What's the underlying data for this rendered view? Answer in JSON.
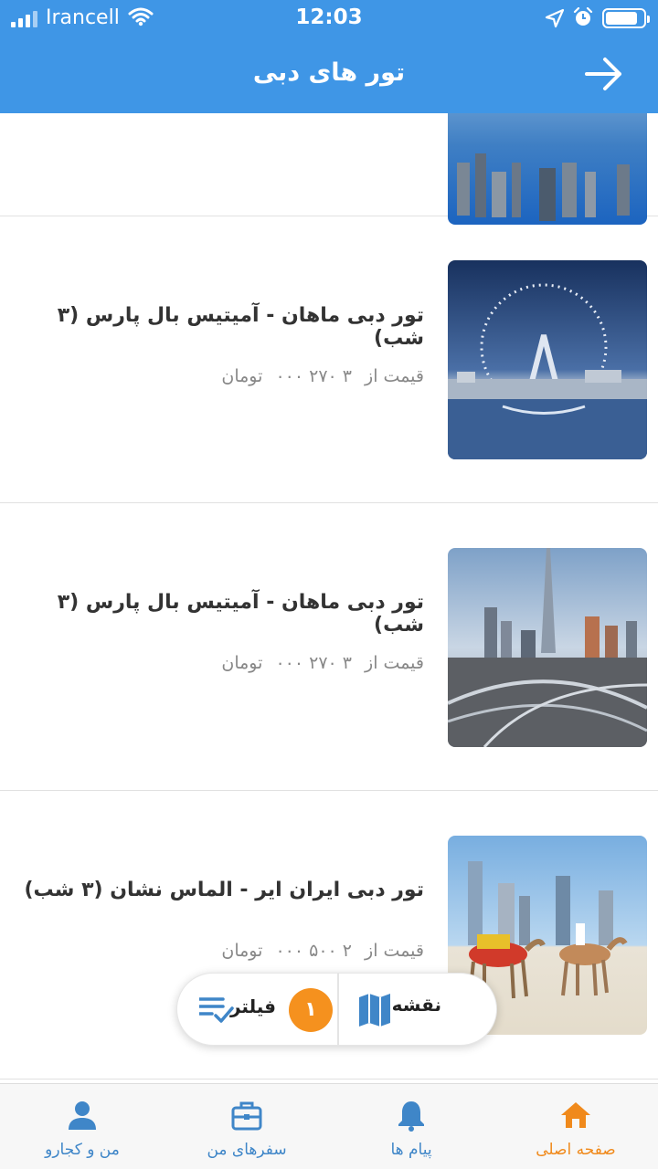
{
  "status_bar": {
    "carrier": "Irancell",
    "time": "12:03",
    "battery_level": 0.85
  },
  "header": {
    "title": "تور های دبی",
    "back_icon": "arrow-right-icon"
  },
  "tours": [
    {
      "title": "تور دبی ماهان - آمیتیس بال پارس (۳ شب)",
      "price_label": "قیمت از",
      "price": "۳ ۲۷۰ ۰۰۰",
      "currency": "تومان",
      "image": "dubai-eye-ferris-wheel"
    },
    {
      "title": "تور دبی ماهان - آمیتیس بال پارس (۳ شب)",
      "price_label": "قیمت از",
      "price": "۳ ۲۷۰ ۰۰۰",
      "currency": "تومان",
      "image": "burj-khalifa-skyline"
    },
    {
      "title": "تور دبی ایران ایر - الماس نشان (۳ شب)",
      "price_label": "قیمت از",
      "price": "۲ ۵۰۰ ۰۰۰",
      "currency": "تومان",
      "image": "camels-on-beach-skyline"
    }
  ],
  "action_pill": {
    "map_label": "نقشه",
    "filter_label": "فیلتر",
    "filter_count": "۱"
  },
  "bottom_nav": {
    "items": [
      {
        "label": "صفحه اصلی",
        "icon": "home-icon",
        "active": true
      },
      {
        "label": "پیام ها",
        "icon": "bell-icon",
        "active": false
      },
      {
        "label": "سفرهای من",
        "icon": "briefcase-icon",
        "active": false
      },
      {
        "label": "من و کجارو",
        "icon": "user-icon",
        "active": false
      }
    ]
  },
  "colors": {
    "primary": "#3f96e6",
    "accent": "#f5911e",
    "nav_active": "#f08a1c",
    "nav_inactive": "#3f86c8"
  }
}
